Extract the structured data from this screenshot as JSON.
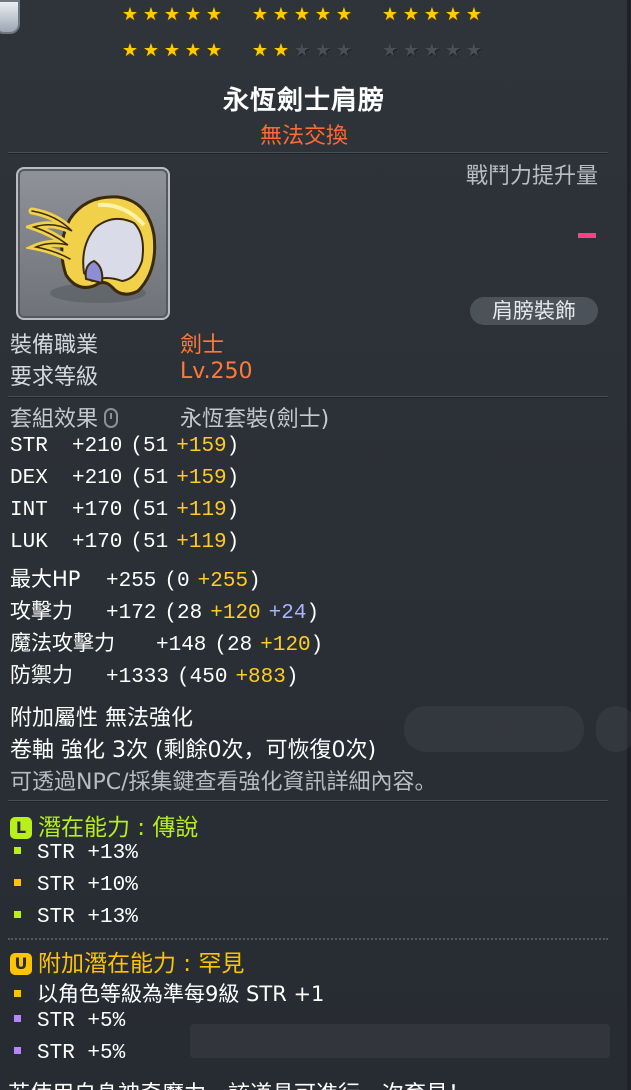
{
  "stars": {
    "row1": [
      [
        1,
        1,
        1,
        1,
        1
      ],
      [
        1,
        1,
        1,
        1,
        1
      ],
      [
        1,
        1,
        1,
        1,
        1
      ]
    ],
    "row2": [
      [
        1,
        1,
        1,
        1,
        1
      ],
      [
        1,
        1,
        0,
        0,
        0
      ],
      [
        0,
        0,
        0,
        0,
        0
      ]
    ]
  },
  "item": {
    "name": "永恆劍士肩膀",
    "trade_status": "無法交換",
    "icon": "shoulder-armor-icon",
    "combat_power_label": "戰鬥力提升量",
    "combat_power_value": "-",
    "category": "肩膀裝飾"
  },
  "requirements": [
    {
      "label": "裝備職業",
      "value": "劍士"
    },
    {
      "label": "要求等級",
      "value": "Lv.250"
    }
  ],
  "set": {
    "label": "套組效果",
    "lock_icon": "lock-icon",
    "name": "永恆套裝(劍士)"
  },
  "stats": [
    {
      "name": "STR",
      "total": "+210",
      "base": "(51",
      "bonus": "+159",
      "extra": "",
      "close": ")"
    },
    {
      "name": "DEX",
      "total": "+210",
      "base": "(51",
      "bonus": "+159",
      "extra": "",
      "close": ")"
    },
    {
      "name": "INT",
      "total": "+170",
      "base": "(51",
      "bonus": "+119",
      "extra": "",
      "close": ")"
    },
    {
      "name": "LUK",
      "total": "+170",
      "base": "(51",
      "bonus": "+119",
      "extra": "",
      "close": ")"
    },
    {
      "name": "最大HP",
      "total": "+255",
      "base": "(0",
      "bonus": "+255",
      "extra": "",
      "close": ")"
    },
    {
      "name": "攻擊力",
      "total": "+172",
      "base": "(28",
      "bonus": "+120",
      "extra": "+24",
      "close": ")"
    },
    {
      "name": "魔法攻擊力",
      "total": "+148",
      "base": "(28",
      "bonus": "+120",
      "extra": "",
      "close": ")"
    },
    {
      "name": "防禦力",
      "total": "+1333",
      "base": "(450",
      "bonus": "+883",
      "extra": "",
      "close": ")"
    }
  ],
  "info": {
    "attr_line": "附加屬性 無法強化",
    "scroll_line": "卷軸 強化 3次 (剩餘0次，可恢復0次)",
    "hint_line": "可透過NPC/採集鍵查看強化資訊詳細內容。"
  },
  "potential": {
    "header": "潛在能力 : 傳說",
    "badge": "L",
    "lines": [
      "STR +13%",
      "STR +10%",
      "STR +13%"
    ]
  },
  "additional_potential": {
    "header": "附加潛在能力 : 罕見",
    "badge": "U",
    "lines": [
      "以角色等級為準每9級 STR +1",
      "STR +5%",
      "STR +5%"
    ]
  },
  "bottom_text": "若使用自身神奇魔力，該道具可進行一次育見！",
  "colors": {
    "accent_gold": "#ffcc22",
    "trade_orange": "#ff6a35",
    "legendary_green": "#b7f01a",
    "rare_yellow": "#ffc400",
    "epic_purple": "#b487ff"
  }
}
